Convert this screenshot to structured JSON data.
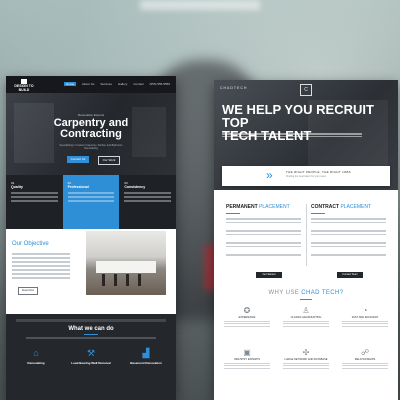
{
  "left_site": {
    "logo": "DESIGN TO BUILD",
    "nav": [
      "Home",
      "About Us",
      "Services",
      "Gallery",
      "Contact"
    ],
    "phone": "(555) 555-5555",
    "hero_eyebrow": "Renovation Experts",
    "hero_title_line1": "Carpentry and",
    "hero_title_line2": "Contracting",
    "hero_text": "Specializing in Custom Carpentry, Kitchen and Bathroom Remodeling",
    "hero_primary": "Contact Us",
    "hero_secondary": "Our Work",
    "features": [
      {
        "num": "01",
        "name": "Quality"
      },
      {
        "num": "02",
        "name": "Professional"
      },
      {
        "num": "03",
        "name": "Consistency"
      }
    ],
    "objective_title": "Our Objective",
    "objective_button": "Read More",
    "services_title": "What we can do",
    "services": [
      "Remodeling",
      "Load Bearing Wall Removal",
      "Basement Renovation"
    ]
  },
  "right_site": {
    "logo": "CHADTECH",
    "logo_mark": "C",
    "hero_title_line1": "WE HELP YOU RECRUIT TOP",
    "hero_title_line2": "TECH TALENT",
    "banner_title": "THE RIGHT PEOPLE, THE RIGHT JOBS",
    "banner_text": "Finding the best talent for your team",
    "permanent_title_bold": "PERMANENT",
    "permanent_title_rest": "PLACEMENT",
    "contract_title_bold": "CONTRACT",
    "contract_title_rest": "PLACEMENT",
    "permanent_button": "Get Started",
    "contract_button": "Contact Team",
    "why_title_pre": "WHY USE",
    "why_title_brand": "CHAD TECH?",
    "why_items": [
      "EXPERIENCE",
      "CLASSIC HEADHUNTING",
      "FAST AND EFFICIENT",
      "INDUSTRY EXPERTS",
      "LARGE NETWORK AND DATABASE",
      "RELATIONSHIPS"
    ]
  }
}
